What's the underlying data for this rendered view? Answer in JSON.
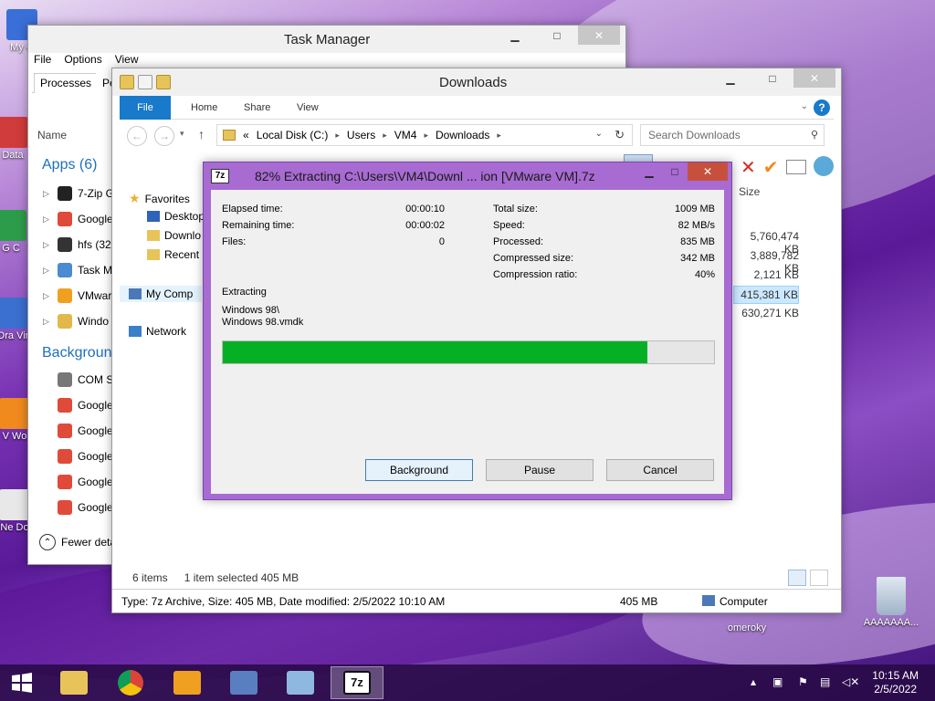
{
  "desktop": {
    "icons": [
      {
        "label": "My C",
        "color": "#3a6fd8"
      },
      {
        "label": "Data",
        "color": "#d03b3b"
      },
      {
        "label": "G C",
        "color": "#2d9c4a"
      },
      {
        "label": "Ora Vir",
        "color": "#3b6fd0"
      },
      {
        "label": "V Wo",
        "color": "#f08a1e"
      },
      {
        "label": "Ne Do",
        "color": "#e8e8e8"
      }
    ],
    "omeroky_label": "omeroky",
    "recycle_label": "AAAAAAA..."
  },
  "task_manager": {
    "title": "Task Manager",
    "menu": [
      "File",
      "Options",
      "View"
    ],
    "tabs": [
      "Processes",
      "Per"
    ],
    "column_name": "Name",
    "apps_header": "Apps (6)",
    "apps": [
      {
        "name": "7-Zip G",
        "color": "#222222"
      },
      {
        "name": "Google",
        "color": "#e04a3a"
      },
      {
        "name": "hfs (32",
        "color": "#333333"
      },
      {
        "name": "Task M",
        "color": "#4b8bd0"
      },
      {
        "name": "VMwar",
        "color": "#f0a020"
      },
      {
        "name": "Windo",
        "color": "#e2b84a"
      }
    ],
    "background_header": "Background",
    "background": [
      {
        "name": "COM S",
        "color": "#777777"
      },
      {
        "name": "Google",
        "color": "#e04a3a"
      },
      {
        "name": "Google",
        "color": "#e04a3a"
      },
      {
        "name": "Google",
        "color": "#e04a3a"
      },
      {
        "name": "Google",
        "color": "#e04a3a"
      },
      {
        "name": "Google",
        "color": "#e04a3a"
      }
    ],
    "fewer_details": "Fewer deta"
  },
  "explorer": {
    "title": "Downloads",
    "ribbon_tabs": [
      "File",
      "Home",
      "Share",
      "View"
    ],
    "address": [
      "Local Disk (C:)",
      "Users",
      "VM4",
      "Downloads"
    ],
    "address_prefix": "«",
    "search_placeholder": "Search Downloads",
    "nav": {
      "favorites": "Favorites",
      "desktop": "Desktop",
      "downloads": "Downlo",
      "recent": "Recent p",
      "computer": "My Comp",
      "network": "Network"
    },
    "size_header": "Size",
    "sizes": [
      "5,760,474 KB",
      "3,889,782 KB",
      "2,121 KB",
      "415,381 KB",
      "630,271 KB"
    ],
    "status_items": "6 items",
    "status_selected": "1 item selected  405 MB",
    "details_text": "Type: 7z Archive, Size: 405 MB, Date modified: 2/5/2022 10:10 AM",
    "details_size": "405 MB",
    "details_location": "Computer"
  },
  "zip_dialog": {
    "title": "82% Extracting C:\\Users\\VM4\\Downl ... ion [VMware VM].7z",
    "icon_text": "7z",
    "elapsed_label": "Elapsed time:",
    "elapsed_value": "00:00:10",
    "remaining_label": "Remaining time:",
    "remaining_value": "00:00:02",
    "files_label": "Files:",
    "files_value": "0",
    "total_label": "Total size:",
    "total_value": "1009 MB",
    "speed_label": "Speed:",
    "speed_value": "82 MB/s",
    "processed_label": "Processed:",
    "processed_value": "835 MB",
    "compressed_label": "Compressed size:",
    "compressed_value": "342 MB",
    "ratio_label": "Compression ratio:",
    "ratio_value": "40%",
    "status": "Extracting",
    "path_line1": "Windows 98\\",
    "path_line2": "Windows 98.vmdk",
    "progress": 0.865,
    "btn_background": "Background",
    "btn_pause": "Pause",
    "btn_cancel": "Cancel"
  },
  "taskbar": {
    "clock_time": "10:15 AM",
    "clock_date": "2/5/2022",
    "apps": [
      {
        "name": "file-explorer",
        "color": "#e8c35a"
      },
      {
        "name": "chrome",
        "color": "#e04a3a"
      },
      {
        "name": "vmware",
        "color": "#f0a020"
      },
      {
        "name": "hfs",
        "color": "#5a7fc0"
      },
      {
        "name": "task-manager",
        "color": "#8fb8e0"
      },
      {
        "name": "7zip",
        "color": "#111111"
      }
    ],
    "active_label": "7z"
  }
}
